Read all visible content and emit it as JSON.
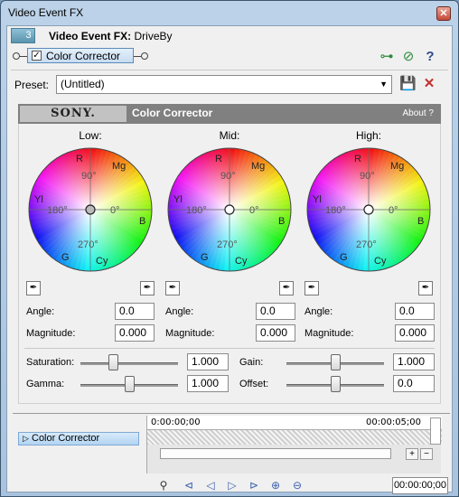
{
  "window": {
    "title": "Video Event FX",
    "close_icon": "close-icon"
  },
  "header": {
    "fx_count": "3",
    "label_bold": "Video Event FX:",
    "label_value": "DriveBy"
  },
  "chain": {
    "plugin_name": "Color Corrector",
    "checked": "✓"
  },
  "preset": {
    "label": "Preset:",
    "value": "(Untitled)"
  },
  "banner": {
    "brand": "SONY.",
    "title": "Color Corrector",
    "about": "About  ?"
  },
  "wheels": [
    {
      "title": "Low:",
      "angle_label": "Angle:",
      "angle_value": "0.0",
      "magnitude_label": "Magnitude:",
      "magnitude_value": "0.000"
    },
    {
      "title": "Mid:",
      "angle_label": "Angle:",
      "angle_value": "0.0",
      "magnitude_label": "Magnitude:",
      "magnitude_value": "0.000"
    },
    {
      "title": "High:",
      "angle_label": "Angle:",
      "angle_value": "0.0",
      "magnitude_label": "Magnitude:",
      "magnitude_value": "0.000"
    }
  ],
  "wheel_labels": {
    "r": "R",
    "mg": "Mg",
    "yl": "Yl",
    "b": "B",
    "g": "G",
    "cy": "Cy",
    "deg90": "90°",
    "deg180": "180°",
    "deg0": "0°",
    "deg270": "270°"
  },
  "sliders": {
    "saturation": {
      "label": "Saturation:",
      "value": "1.000",
      "level": 0.33
    },
    "gamma": {
      "label": "Gamma:",
      "value": "1.000",
      "level": 0.5
    },
    "gain": {
      "label": "Gain:",
      "value": "1.000",
      "level": 0.5
    },
    "offset": {
      "label": "Offset:",
      "value": "0.0",
      "level": 0.5
    }
  },
  "timeline": {
    "track": "Color Corrector",
    "start_time": "0:00:00;00",
    "end_time": "00:00:05;00",
    "timecode": "00:00:00;00"
  }
}
